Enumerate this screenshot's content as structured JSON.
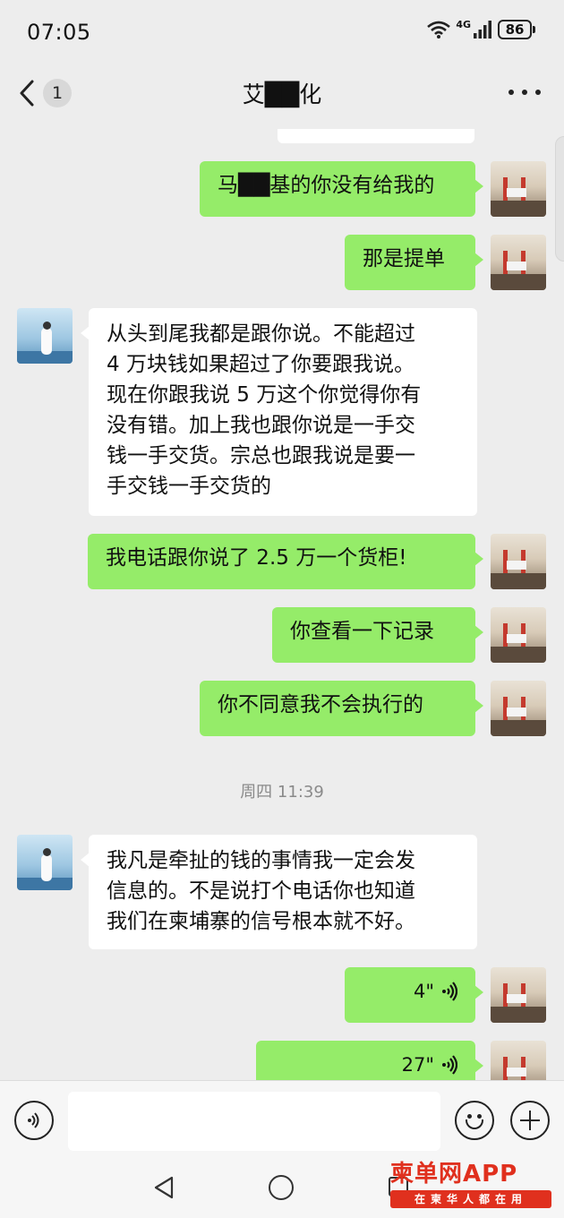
{
  "status_bar": {
    "time": "07:05",
    "network": "4G",
    "battery": "86"
  },
  "header": {
    "back_badge": "1",
    "title": "艾██化"
  },
  "messages": [
    {
      "side": "sent",
      "type": "text",
      "text": "马██基的你没有给我的"
    },
    {
      "side": "sent",
      "type": "text",
      "text": "那是提单"
    },
    {
      "side": "recv",
      "type": "text",
      "lines": [
        "从头到尾我都是跟你说。不能超过",
        "4 万块钱如果超过了你要跟我说。",
        "现在你跟我说 5 万这个你觉得你有",
        "没有错。加上我也跟你说是一手交",
        "钱一手交货。宗总也跟我说是要一",
        "手交钱一手交货的"
      ]
    },
    {
      "side": "sent",
      "type": "text",
      "text": "我电话跟你说了 2.5 万一个货柜!"
    },
    {
      "side": "sent",
      "type": "text",
      "text": "你查看一下记录"
    },
    {
      "side": "sent",
      "type": "text",
      "text": "你不同意我不会执行的"
    },
    {
      "side": "recv",
      "type": "text",
      "lines": [
        "我凡是牵扯的钱的事情我一定会发",
        "信息的。不是说打个电话你也知道",
        "我们在柬埔寨的信号根本就不好。"
      ]
    },
    {
      "side": "sent",
      "type": "voice",
      "duration": "4\""
    },
    {
      "side": "sent",
      "type": "voice",
      "duration": "27\""
    }
  ],
  "timestamp": "周四 11:39",
  "input": {
    "placeholder": ""
  },
  "watermark": {
    "logo": "柬单网APP",
    "tagline": "在柬华人都在用"
  },
  "icons": [
    "back-chevron-icon",
    "more-icon",
    "wifi-icon",
    "signal-icon",
    "battery-icon",
    "voice-input-icon",
    "emoji-icon",
    "plus-icon",
    "voice-wave-icon",
    "nav-back-icon",
    "nav-home-icon",
    "nav-recent-icon"
  ]
}
